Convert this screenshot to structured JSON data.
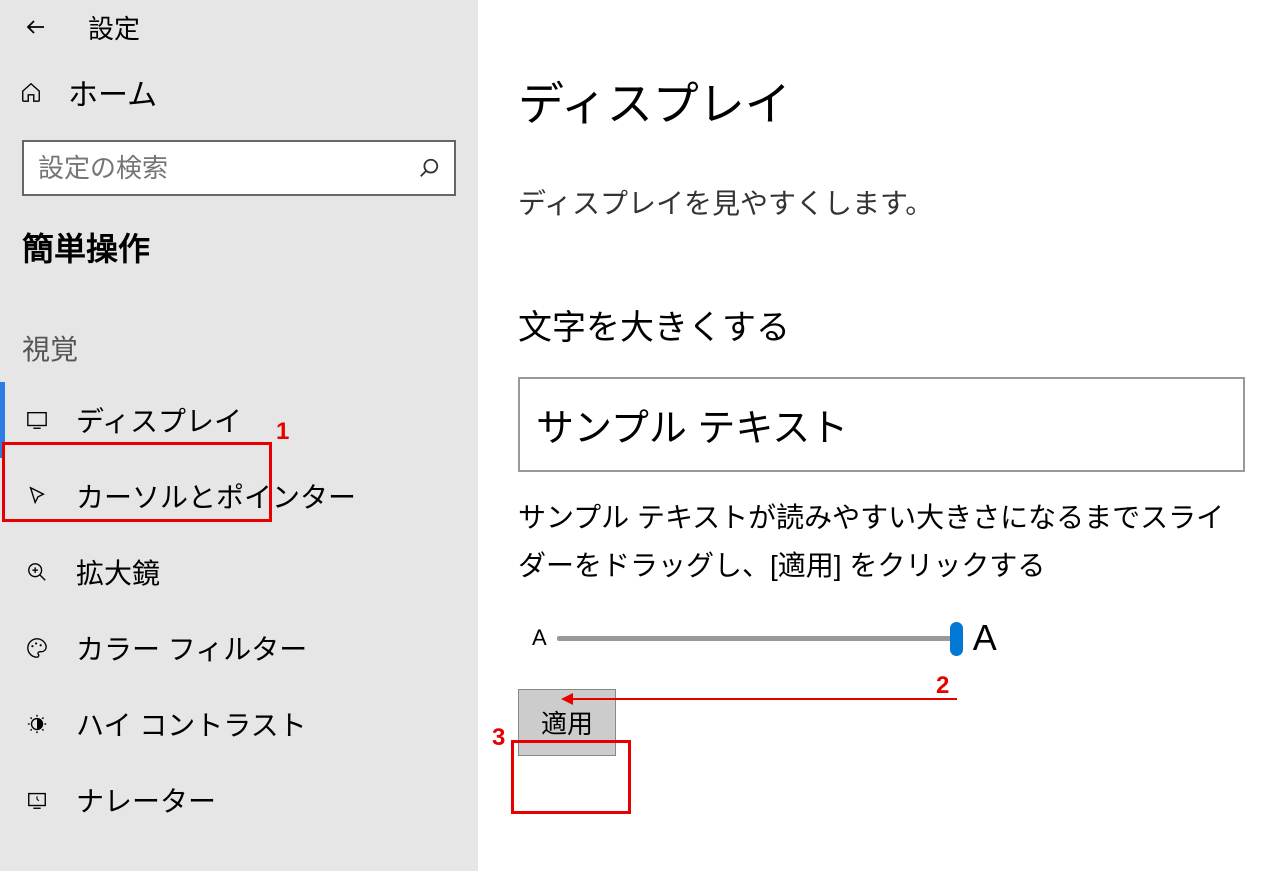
{
  "titlebar": {
    "title": "設定"
  },
  "sidebar": {
    "home": "ホーム",
    "search_placeholder": "設定の検索",
    "category": "簡単操作",
    "group": "視覚",
    "items": [
      {
        "label": "ディスプレイ",
        "icon": "display"
      },
      {
        "label": "カーソルとポインター",
        "icon": "cursor"
      },
      {
        "label": "拡大鏡",
        "icon": "magnifier"
      },
      {
        "label": "カラー フィルター",
        "icon": "palette"
      },
      {
        "label": "ハイ コントラスト",
        "icon": "contrast"
      },
      {
        "label": "ナレーター",
        "icon": "narrator"
      }
    ]
  },
  "main": {
    "title": "ディスプレイ",
    "subtitle": "ディスプレイを見やすくします。",
    "section": "文字を大きくする",
    "sample": "サンプル テキスト",
    "help": "サンプル テキストが読みやすい大きさになるまでスライダーをドラッグし、[適用] をクリックする",
    "slider_small": "A",
    "slider_big": "A",
    "apply": "適用"
  },
  "annotations": {
    "n1": "1",
    "n2": "2",
    "n3": "3"
  }
}
